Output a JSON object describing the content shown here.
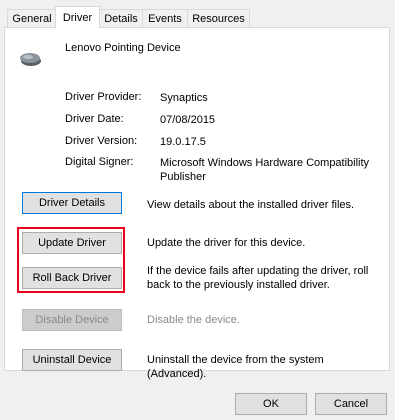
{
  "tabs": [
    "General",
    "Driver",
    "Details",
    "Events",
    "Resources"
  ],
  "active_tab": "Driver",
  "device": {
    "name": "Lenovo Pointing Device",
    "icon": "mouse-icon"
  },
  "properties": [
    {
      "label": "Driver Provider:",
      "value": "Synaptics"
    },
    {
      "label": "Driver Date:",
      "value": "07/08/2015"
    },
    {
      "label": "Driver Version:",
      "value": "19.0.17.5"
    },
    {
      "label": "Digital Signer:",
      "value": "Microsoft Windows Hardware Compatibility Publisher"
    }
  ],
  "actions": {
    "driver_details": {
      "label": "Driver Details",
      "desc": "View details about the installed driver files."
    },
    "update_driver": {
      "label": "Update Driver",
      "desc": "Update the driver for this device."
    },
    "roll_back": {
      "label": "Roll Back Driver",
      "desc": "If the device fails after updating the driver, roll back to the previously installed driver."
    },
    "disable_device": {
      "label": "Disable Device",
      "desc": "Disable the device.",
      "enabled": false
    },
    "uninstall_device": {
      "label": "Uninstall Device",
      "desc": "Uninstall the device from the system (Advanced)."
    }
  },
  "footer": {
    "ok": "OK",
    "cancel": "Cancel"
  },
  "colors": {
    "highlight": "#e8001c",
    "focus_border": "#0078d7"
  }
}
